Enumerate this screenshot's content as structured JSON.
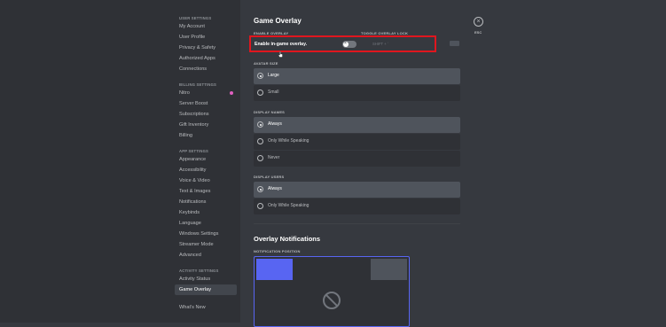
{
  "sidebar": {
    "sections": [
      {
        "category": "USER SETTINGS",
        "items": [
          "My Account",
          "User Profile",
          "Privacy & Safety",
          "Authorized Apps",
          "Connections"
        ]
      },
      {
        "category": "BILLING SETTINGS",
        "items": [
          "Nitro",
          "Server Boost",
          "Subscriptions",
          "Gift Inventory",
          "Billing"
        ]
      },
      {
        "category": "APP SETTINGS",
        "items": [
          "Appearance",
          "Accessibility",
          "Voice & Video",
          "Text & Images",
          "Notifications",
          "Keybinds",
          "Language",
          "Windows Settings",
          "Streamer Mode",
          "Advanced"
        ]
      },
      {
        "category": "ACTIVITY SETTINGS",
        "items": [
          "Activity Status",
          "Game Overlay"
        ]
      },
      {
        "category": "",
        "items": [
          "What's New"
        ]
      }
    ],
    "selected": "Game Overlay"
  },
  "main": {
    "title": "Game Overlay",
    "enable_overlay_label": "ENABLE OVERLAY",
    "toggle_lock_label": "TOGGLE OVERLAY LOCK",
    "enable_text": "Enable in-game overlay.",
    "keybind_value": "SHIFT + `",
    "avatar_size": {
      "label": "AVATAR SIZE",
      "options": [
        "Large",
        "Small"
      ],
      "selected": "Large"
    },
    "display_names": {
      "label": "DISPLAY NAMES",
      "options": [
        "Always",
        "Only While Speaking",
        "Never"
      ],
      "selected": "Always"
    },
    "display_users": {
      "label": "DISPLAY USERS",
      "options": [
        "Always",
        "Only While Speaking"
      ],
      "selected": "Always"
    },
    "notifications_title": "Overlay Notifications",
    "notification_position_label": "NOTIFICATION POSITION",
    "close_label": "ESC"
  },
  "colors": {
    "accent": "#5865f2",
    "highlight": "#e0161e",
    "nitro": "#e060c0"
  }
}
